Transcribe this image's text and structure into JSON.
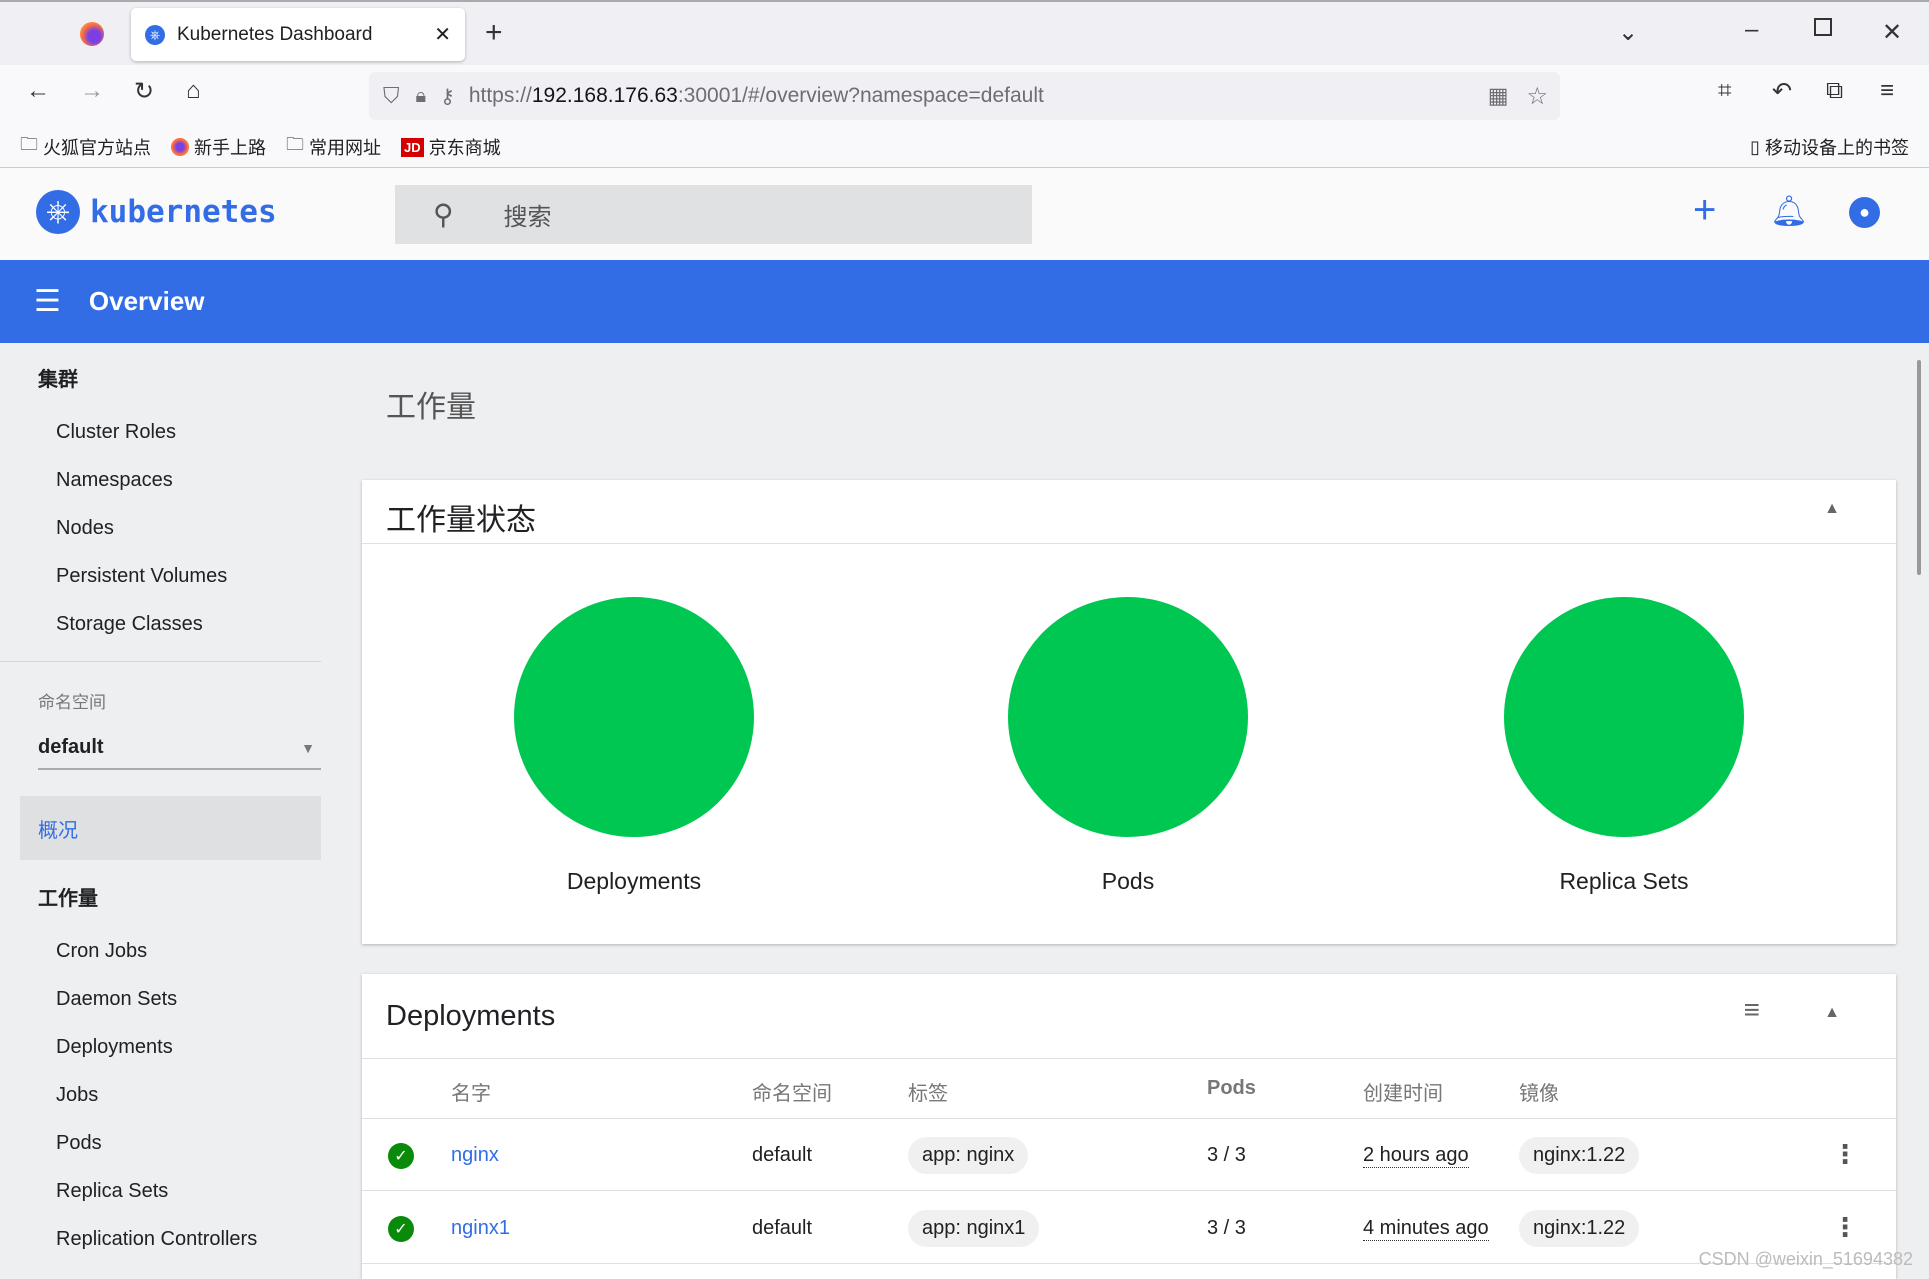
{
  "browser": {
    "tab_title": "Kubernetes Dashboard",
    "url_prefix": "https://",
    "url_host": "192.168.176.63",
    "url_rest": ":30001/#/overview?namespace=default",
    "bookmarks": [
      "火狐官方站点",
      "新手上路",
      "常用网址",
      "京东商城"
    ],
    "mobile_bookmarks": "移动设备上的书签"
  },
  "app": {
    "logo_text": "kubernetes",
    "search_placeholder": "搜索",
    "page_title": "Overview",
    "brand_color": "#326de6"
  },
  "sidebar": {
    "cluster_heading": "集群",
    "cluster_items": [
      "Cluster Roles",
      "Namespaces",
      "Nodes",
      "Persistent Volumes",
      "Storage Classes"
    ],
    "namespace_label": "命名空间",
    "namespace_value": "default",
    "overview": "概况",
    "workloads_heading": "工作量",
    "workload_items": [
      "Cron Jobs",
      "Daemon Sets",
      "Deployments",
      "Jobs",
      "Pods",
      "Replica Sets",
      "Replication Controllers"
    ]
  },
  "main": {
    "section_title": "工作量",
    "status_card": {
      "title": "工作量状态",
      "charts": [
        {
          "label": "Deployments",
          "status_color": "#00c752",
          "running_pct": 100
        },
        {
          "label": "Pods",
          "status_color": "#00c752",
          "running_pct": 100
        },
        {
          "label": "Replica Sets",
          "status_color": "#00c752",
          "running_pct": 100
        }
      ]
    },
    "deployments": {
      "title": "Deployments",
      "columns": [
        "名字",
        "命名空间",
        "标签",
        "Pods",
        "创建时间",
        "镜像"
      ],
      "rows": [
        {
          "name": "nginx",
          "namespace": "default",
          "label": "app: nginx",
          "pods": "3 / 3",
          "created": "2 hours ago",
          "image": "nginx:1.22"
        },
        {
          "name": "nginx1",
          "namespace": "default",
          "label": "app: nginx1",
          "pods": "3 / 3",
          "created": "4 minutes ago",
          "image": "nginx:1.22"
        }
      ]
    }
  },
  "watermark": "CSDN @weixin_51694382"
}
